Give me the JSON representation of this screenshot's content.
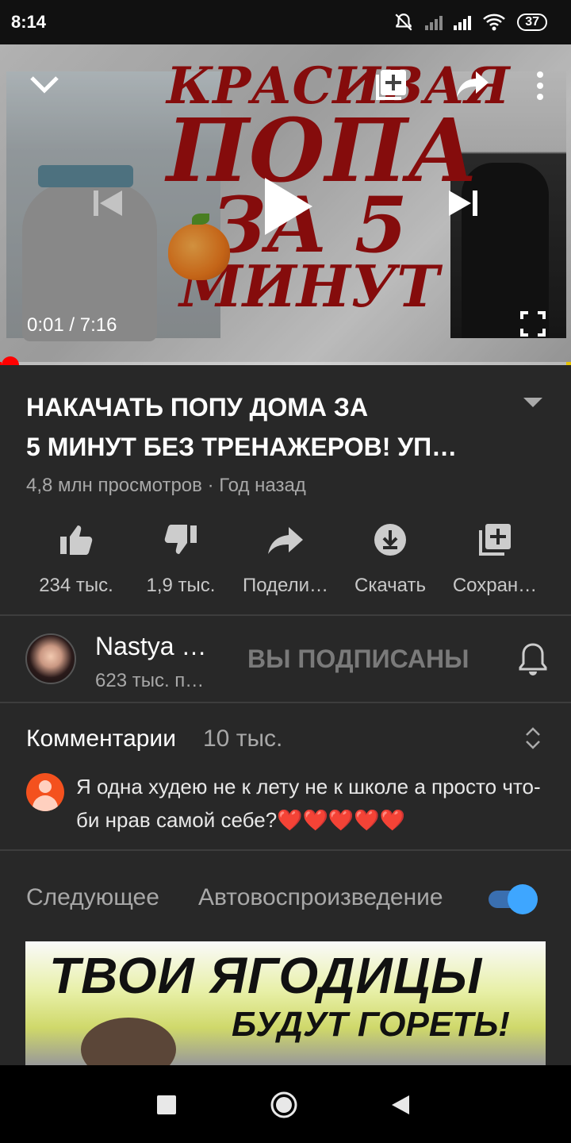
{
  "status_bar": {
    "time": "8:14",
    "battery": "37",
    "icons": [
      "mute-icon",
      "signal-icon",
      "signal-icon",
      "wifi-icon",
      "battery-icon"
    ]
  },
  "player": {
    "thumbnail_text": [
      "КРАСИВАЯ",
      "ПОПА",
      "ЗА 5",
      "МИНУТ"
    ],
    "current_time": "0:01",
    "duration": "7:16",
    "time_readout": "0:01 / 7:16",
    "progress_fraction": 0.0023,
    "controls": [
      "chevron-down-icon",
      "add-to-queue-icon",
      "share-icon",
      "more-vert-icon",
      "skip-previous-icon",
      "play-icon",
      "skip-next-icon",
      "fullscreen-icon"
    ]
  },
  "video": {
    "title_line1": "НАКАЧАТЬ ПОПУ ДОМА ЗА",
    "title_line2": "5 МИНУТ БЕЗ ТРЕНАЖЕРОВ! УП…",
    "meta": "4,8 млн просмотров · Год назад"
  },
  "actions": [
    {
      "icon": "thumb-up-icon",
      "label": "234 тыс."
    },
    {
      "icon": "thumb-down-icon",
      "label": "1,9 тыс."
    },
    {
      "icon": "share-icon",
      "label": "Подели…"
    },
    {
      "icon": "download-icon",
      "label": "Скачать"
    },
    {
      "icon": "add-to-playlist-icon",
      "label": "Сохран…"
    }
  ],
  "channel": {
    "name": "Nastya …",
    "subscribers": "623 тыс. п…",
    "subscribe_state": "ВЫ ПОДПИСАНЫ"
  },
  "comments": {
    "title": "Комментарии",
    "count": "10 тыс.",
    "top_comment": "Я одна худею не к лету не к школе а просто что-би нрав самой себе?❤️❤️❤️❤️❤️"
  },
  "up_next": {
    "label": "Следующее",
    "autoplay_label": "Автовоспроизведение",
    "autoplay_on": true,
    "thumbnail_text_1": "ТВОИ ЯГОДИЦЫ",
    "thumbnail_text_2": "БУДУТ ГОРЕТЬ!"
  },
  "colors": {
    "background": "#282828",
    "accent_red": "#ff0000",
    "toggle_blue": "#3ea6ff"
  }
}
